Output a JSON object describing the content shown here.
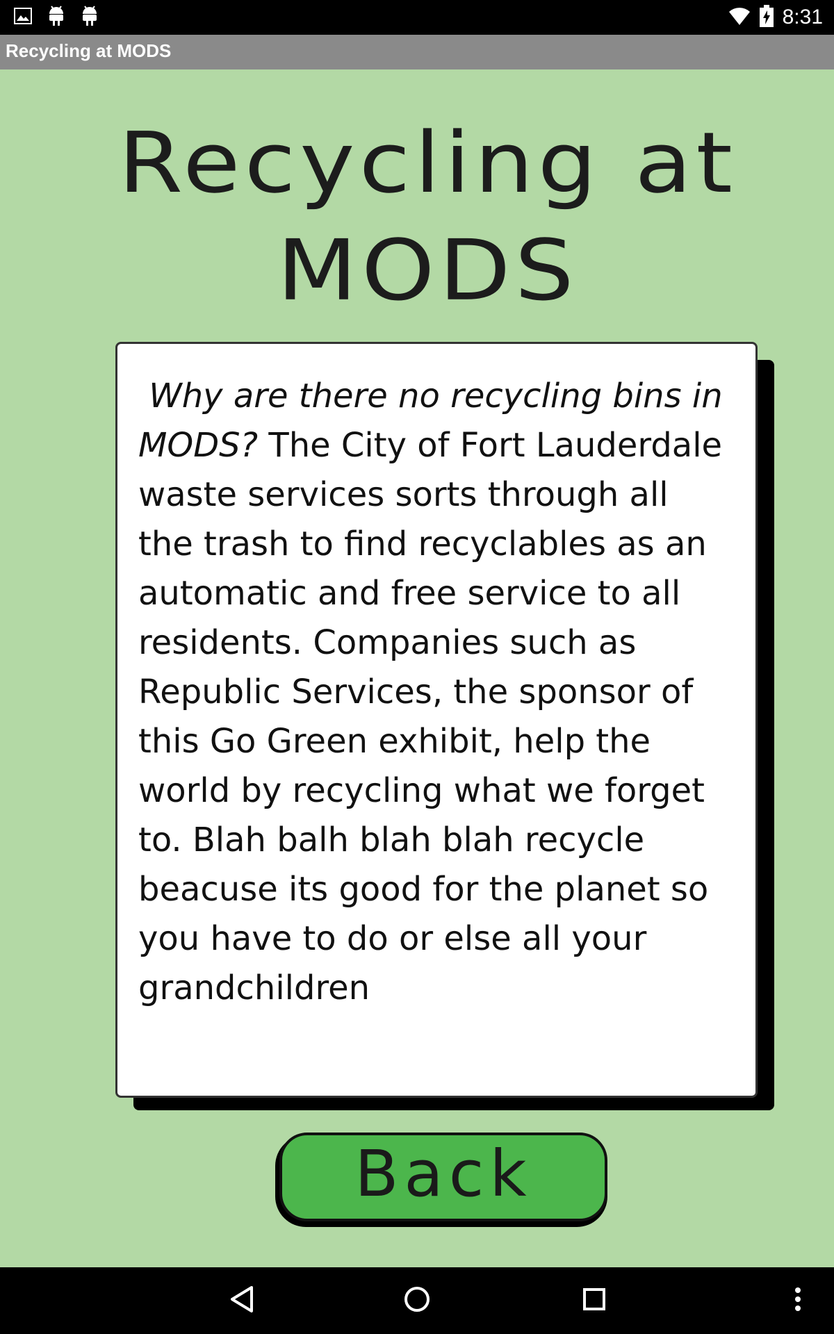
{
  "status_bar": {
    "time": "8:31",
    "icons_left": [
      "image-icon",
      "android-icon",
      "android-icon"
    ],
    "icons_right": [
      "wifi-icon",
      "battery-icon"
    ]
  },
  "app_bar": {
    "title": "Recycling at MODS"
  },
  "heading": {
    "line1": "Recycling at",
    "line2": "MODS"
  },
  "article": {
    "question": "Why are there no recycling bins in MODS?",
    "body": "The City of Fort Lauderdale waste services sorts through all the trash to find recyclables as an automatic and free service to all residents. Companies such as Republic Services, the sponsor of this Go Green exhibit, help the world by recycling what we forget to. Blah balh blah blah recycle beacuse its good for the planet so you have to do or else all your grandchildren"
  },
  "back_button": {
    "label": "Back"
  },
  "nav_bar": {
    "buttons": [
      "back-icon",
      "home-icon",
      "recents-icon",
      "overflow-menu-icon"
    ]
  },
  "colors": {
    "background": "#b3d9a5",
    "button": "#4cb64c",
    "title_bar": "#8a8a8a"
  }
}
